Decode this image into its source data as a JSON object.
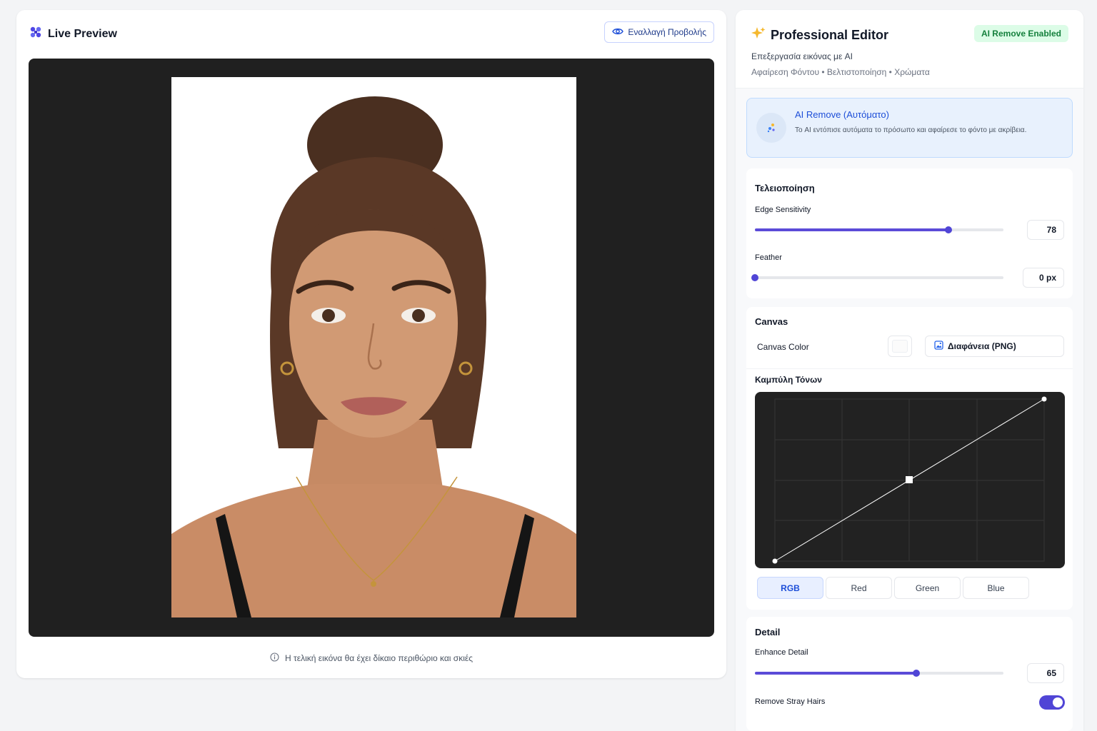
{
  "preview": {
    "title": "Live Preview",
    "toggle_button_label": "Εναλλαγή Προβολής",
    "note": "Η τελική εικόνα θα έχει δίκαιο περιθώριο και σκιές"
  },
  "editor": {
    "title": "Professional Editor",
    "badge": "AI Remove Enabled",
    "subtitle": "Επεξεργασία εικόνας με AI",
    "features": "Αφαίρεση Φόντου • Βελτιστοποίηση • Χρώματα"
  },
  "ai_remove": {
    "title": "AI Remove (Αυτόματο)",
    "description": "Το AI εντόπισε αυτόματα το πρόσωπο και αφαίρεσε το φόντο με ακρίβεια."
  },
  "finishing": {
    "title": "Τελειοποίηση",
    "edge_label": "Edge Sensitivity",
    "edge_value": 78,
    "edge_display": "78",
    "feather_label": "Feather",
    "feather_value": 0,
    "feather_display": "0 px"
  },
  "canvas": {
    "title": "Canvas",
    "color_label": "Canvas Color",
    "background_option": "Διαφάνεια (PNG)"
  },
  "tone_curve": {
    "title": "Καμπύλη Τόνων",
    "channels": [
      "RGB",
      "Red",
      "Green",
      "Blue"
    ],
    "active_channel": "RGB"
  },
  "detail": {
    "title": "Detail",
    "enhance_label": "Enhance Detail",
    "enhance_value": 65,
    "enhance_display": "65",
    "stray_hairs_label": "Remove Stray Hairs",
    "stray_hairs_enabled": true
  },
  "colors": {
    "accent": "#5045d6",
    "ai_blue": "#1d4ed8",
    "badge_green": "#15803d"
  }
}
